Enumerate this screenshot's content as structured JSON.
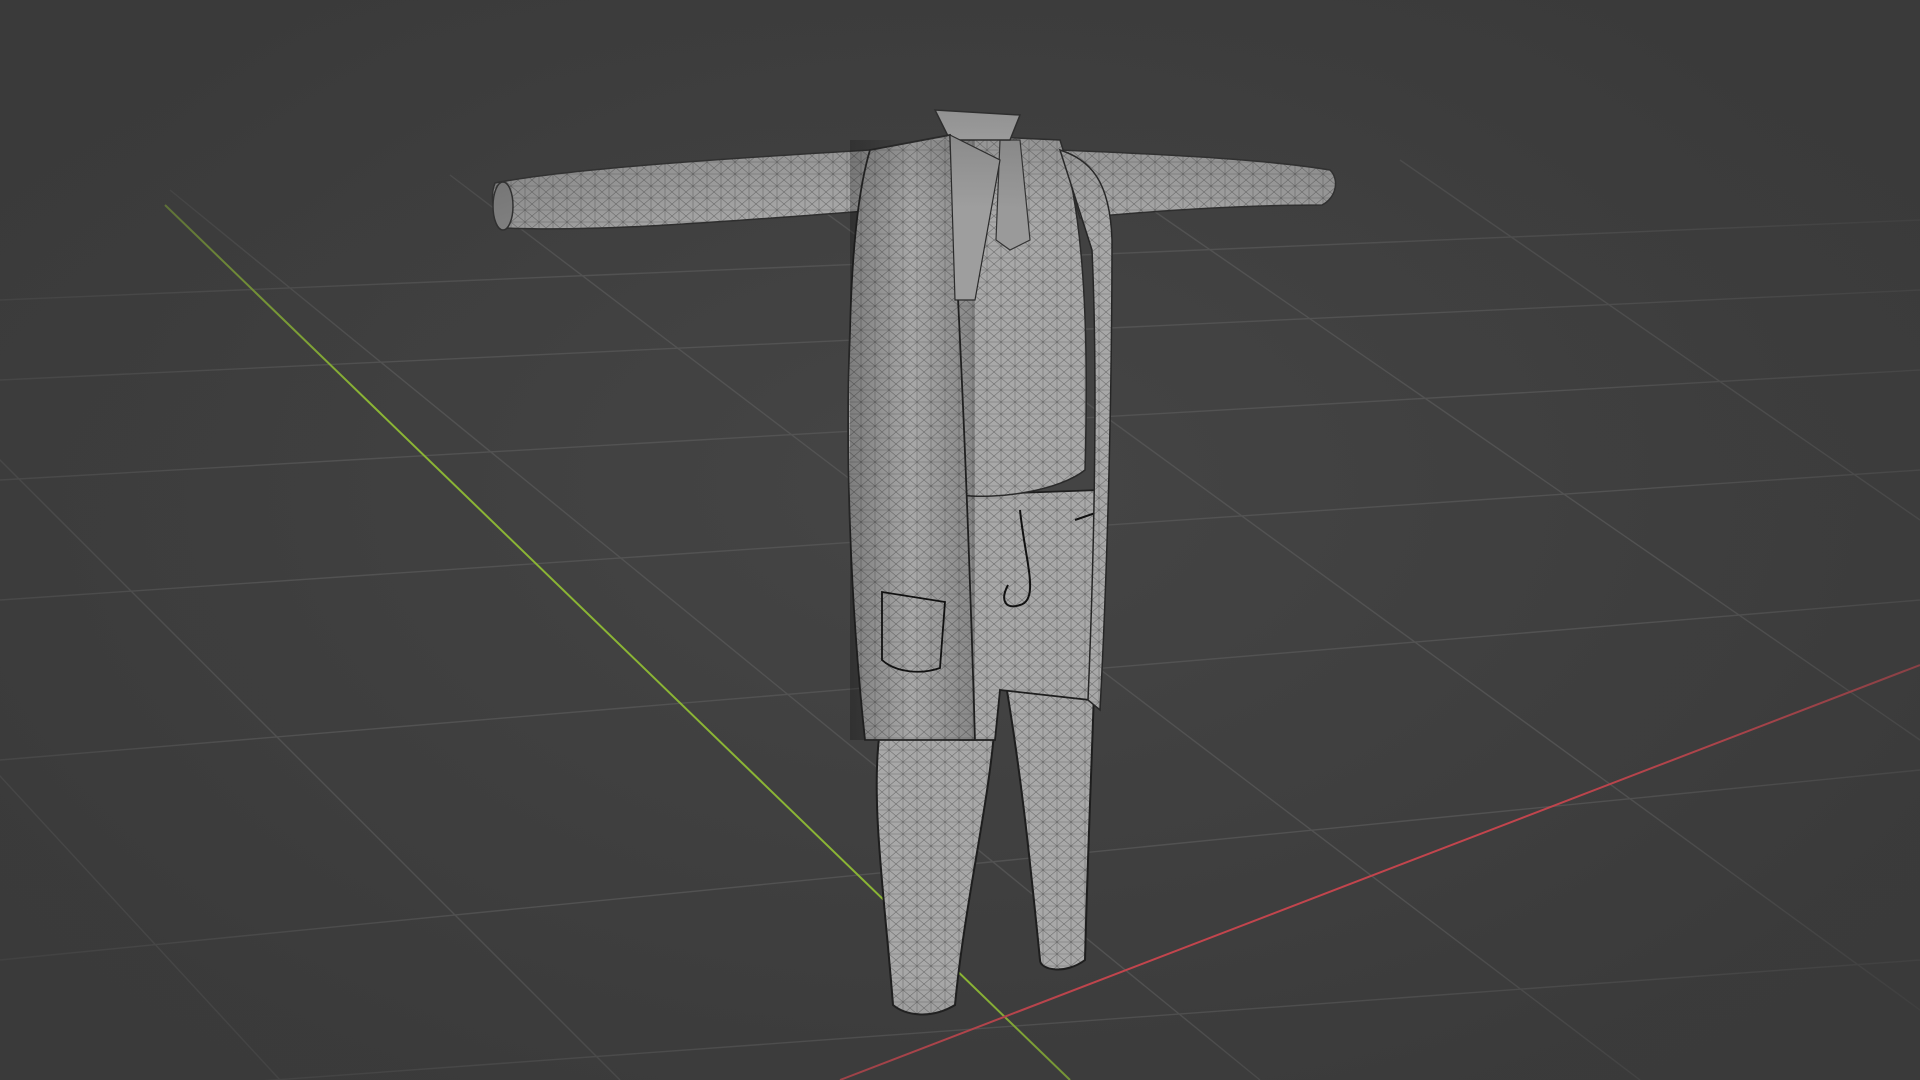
{
  "viewport": {
    "background_color": "#3d3d3d",
    "grid_color": "#575757",
    "x_axis_color": "#c2454d",
    "y_axis_color": "#8bb535",
    "mesh_fill_color": "#a6a6a6",
    "mesh_wire_color": "#4a4a4a",
    "seam_color": "#161616",
    "object": "clothing-mesh",
    "shading": "solid",
    "overlay_wireframe": true
  }
}
